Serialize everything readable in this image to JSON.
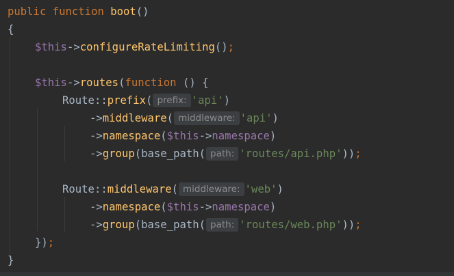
{
  "editor": {
    "l1": {
      "kw1": "public",
      "kw2": "function",
      "fn": "boot",
      "rest": "()"
    },
    "l2": {
      "text": "{"
    },
    "l3": {
      "var": "$this",
      "arrow": "->",
      "meth": "configureRateLimiting",
      "paren": "()",
      "semi": ";"
    },
    "l5": {
      "var": "$this",
      "arrow": "->",
      "meth": "routes",
      "open": "(",
      "kw": "function",
      "rest": " () {"
    },
    "l6": {
      "cls": "Route",
      "sep": "::",
      "meth": "prefix",
      "open": "(",
      "hint": "prefix:",
      "str": "'api'",
      "close": ")"
    },
    "l7": {
      "arrow": "->",
      "meth": "middleware",
      "open": "(",
      "hint": "middleware:",
      "str": "'api'",
      "close": ")"
    },
    "l8": {
      "arrow": "->",
      "meth": "namespace",
      "open": "(",
      "var": "$this",
      "arrow2": "->",
      "fld": "namespace",
      "close": ")"
    },
    "l9": {
      "arrow": "->",
      "meth": "group",
      "open": "(base_path(",
      "hint": "path:",
      "str": "'routes/api.php'",
      "close": "))",
      "semi": ";"
    },
    "l11": {
      "cls": "Route",
      "sep": "::",
      "meth": "middleware",
      "open": "(",
      "hint": "middleware:",
      "str": "'web'",
      "close": ")"
    },
    "l12": {
      "arrow": "->",
      "meth": "namespace",
      "open": "(",
      "var": "$this",
      "arrow2": "->",
      "fld": "namespace",
      "close": ")"
    },
    "l13": {
      "arrow": "->",
      "meth": "group",
      "open": "(base_path(",
      "hint": "path:",
      "str": "'routes/web.php'",
      "close": "))",
      "semi": ";"
    },
    "l14": {
      "close": "})",
      "semi": ";"
    },
    "l15": {
      "text": "}"
    }
  },
  "colors": {
    "background": "#2b2b2b",
    "keyword": "#cc7832",
    "function": "#ffc66d",
    "variable": "#9876aa",
    "string": "#6a8759",
    "text": "#a9b7c6",
    "hint_bg": "#3b3f41",
    "hint_text": "#8c8c8c"
  }
}
